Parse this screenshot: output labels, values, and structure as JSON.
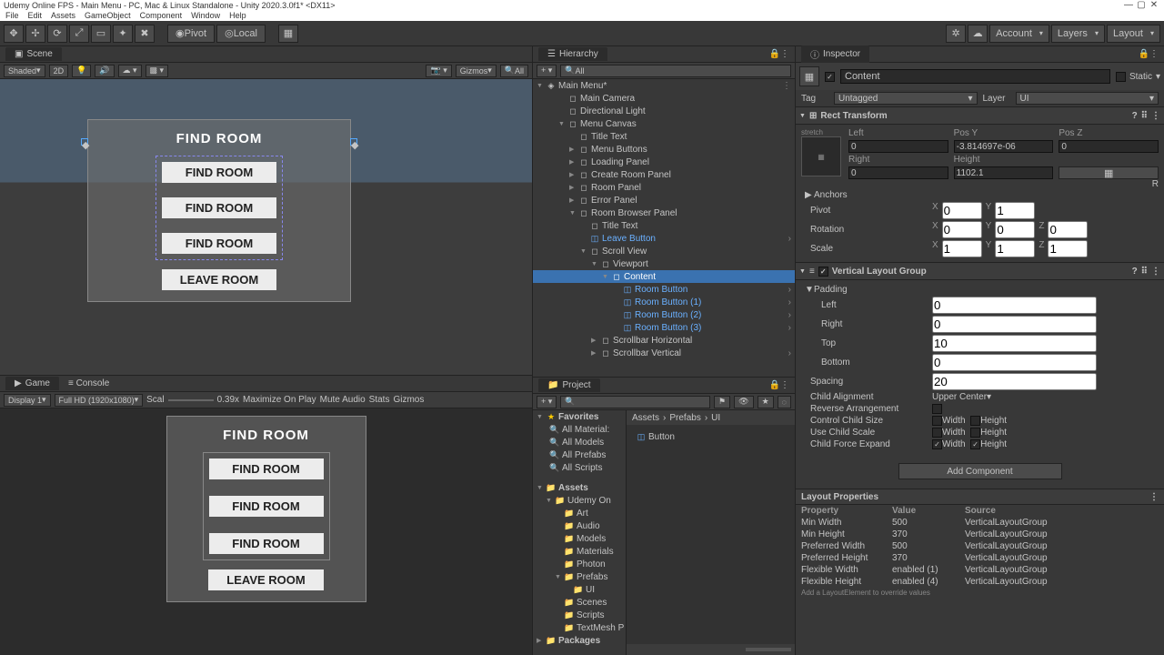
{
  "title": "Udemy Online FPS - Main Menu - PC, Mac & Linux Standalone - Unity 2020.3.0f1* <DX11>",
  "menubar": [
    "File",
    "Edit",
    "Assets",
    "GameObject",
    "Component",
    "Window",
    "Help"
  ],
  "toolbar": {
    "pivot": "Pivot",
    "local": "Local",
    "account": "Account",
    "layers": "Layers",
    "layout": "Layout"
  },
  "scene": {
    "tab": "Scene",
    "shading": "Shaded",
    "mode2d": "2D",
    "gizmos": "Gizmos",
    "search_ph": "All"
  },
  "game": {
    "tab_game": "Game",
    "tab_console": "Console",
    "display": "Display 1",
    "res": "Full HD (1920x1080)",
    "scale_label": "Scal",
    "scale": "0.39x",
    "opts": [
      "Maximize On Play",
      "Mute Audio",
      "Stats",
      "Gizmos"
    ]
  },
  "ui_preview": {
    "title": "FIND ROOM",
    "btns": [
      "FIND ROOM",
      "FIND ROOM",
      "FIND ROOM"
    ],
    "leave": "LEAVE ROOM"
  },
  "hierarchy": {
    "tab": "Hierarchy",
    "search_ph": "All",
    "root": "Main Menu*",
    "items": [
      {
        "t": "Main Camera",
        "d": 2
      },
      {
        "t": "Directional Light",
        "d": 2
      },
      {
        "t": "Menu Canvas",
        "d": 2,
        "a": 1
      },
      {
        "t": "Title Text",
        "d": 3
      },
      {
        "t": "Menu Buttons",
        "d": 3,
        "c": 1
      },
      {
        "t": "Loading Panel",
        "d": 3,
        "c": 1
      },
      {
        "t": "Create Room Panel",
        "d": 3,
        "c": 1
      },
      {
        "t": "Room Panel",
        "d": 3,
        "c": 1
      },
      {
        "t": "Error Panel",
        "d": 3,
        "c": 1
      },
      {
        "t": "Room Browser Panel",
        "d": 3,
        "a": 1
      },
      {
        "t": "Title Text",
        "d": 4
      },
      {
        "t": "Leave Button",
        "d": 4,
        "p": 1,
        "m": 1
      },
      {
        "t": "Scroll View",
        "d": 4,
        "a": 1
      },
      {
        "t": "Viewport",
        "d": 5,
        "a": 1
      },
      {
        "t": "Content",
        "d": 6,
        "sel": 1,
        "a": 1
      },
      {
        "t": "Room Button",
        "d": 7,
        "p": 1,
        "m": 1
      },
      {
        "t": "Room Button (1)",
        "d": 7,
        "p": 1,
        "m": 1
      },
      {
        "t": "Room Button (2)",
        "d": 7,
        "p": 1,
        "m": 1
      },
      {
        "t": "Room Button (3)",
        "d": 7,
        "p": 1,
        "m": 1
      },
      {
        "t": "Scrollbar Horizontal",
        "d": 5,
        "c": 1
      },
      {
        "t": "Scrollbar Vertical",
        "d": 5,
        "c": 1,
        "m": 1
      }
    ]
  },
  "project": {
    "tab": "Project",
    "search_ph": "",
    "favorites_label": "Favorites",
    "favorites": [
      "All Material:",
      "All Models",
      "All Prefabs",
      "All Scripts"
    ],
    "assets_label": "Assets",
    "tree": [
      {
        "t": "Udemy On",
        "d": 1,
        "a": 1
      },
      {
        "t": "Art",
        "d": 2
      },
      {
        "t": "Audio",
        "d": 2
      },
      {
        "t": "Models",
        "d": 2
      },
      {
        "t": "Materials",
        "d": 2
      },
      {
        "t": "Photon",
        "d": 2
      },
      {
        "t": "Prefabs",
        "d": 2,
        "a": 1
      },
      {
        "t": "UI",
        "d": 3
      },
      {
        "t": "Scenes",
        "d": 2
      },
      {
        "t": "Scripts",
        "d": 2
      },
      {
        "t": "TextMesh P",
        "d": 2
      }
    ],
    "packages_label": "Packages",
    "breadcrumb": [
      "Assets",
      "Prefabs",
      "UI"
    ],
    "content_item": "Button"
  },
  "inspector": {
    "tab": "Inspector",
    "name": "Content",
    "static": "Static",
    "tag_label": "Tag",
    "tag": "Untagged",
    "layer_label": "Layer",
    "layer": "UI",
    "rect": {
      "header": "Rect Transform",
      "anchor": "stretch",
      "labels": [
        "Left",
        "Pos Y",
        "Pos Z",
        "Right",
        "Height"
      ],
      "vals": [
        "0",
        "-3.814697e-06",
        "0",
        "0",
        "1102.1"
      ],
      "r_lbl": "R"
    },
    "anchors": "Anchors",
    "pivot": {
      "l": "Pivot",
      "x": "0",
      "y": "1"
    },
    "rotation": {
      "l": "Rotation",
      "x": "0",
      "y": "0",
      "z": "0"
    },
    "scale": {
      "l": "Scale",
      "x": "1",
      "y": "1",
      "z": "1"
    },
    "vlg": {
      "header": "Vertical Layout Group",
      "padding": "Padding",
      "left": "0",
      "right": "0",
      "top": "10",
      "bottom": "0",
      "spacing_l": "Spacing",
      "spacing": "20",
      "align_l": "Child Alignment",
      "align": "Upper Center",
      "reverse_l": "Reverse Arrangement",
      "ctrl_l": "Control Child Size",
      "usescale_l": "Use Child Scale",
      "force_l": "Child Force Expand",
      "width": "Width",
      "height": "Height"
    },
    "add_comp": "Add Component",
    "layout": {
      "header": "Layout Properties",
      "cols": [
        "Property",
        "Value",
        "Source"
      ],
      "rows": [
        [
          "Min Width",
          "500",
          "VerticalLayoutGroup"
        ],
        [
          "Min Height",
          "370",
          "VerticalLayoutGroup"
        ],
        [
          "Preferred Width",
          "500",
          "VerticalLayoutGroup"
        ],
        [
          "Preferred Height",
          "370",
          "VerticalLayoutGroup"
        ],
        [
          "Flexible Width",
          "enabled (1)",
          "VerticalLayoutGroup"
        ],
        [
          "Flexible Height",
          "enabled (4)",
          "VerticalLayoutGroup"
        ]
      ],
      "footer": "Add a LayoutElement to override values"
    }
  }
}
